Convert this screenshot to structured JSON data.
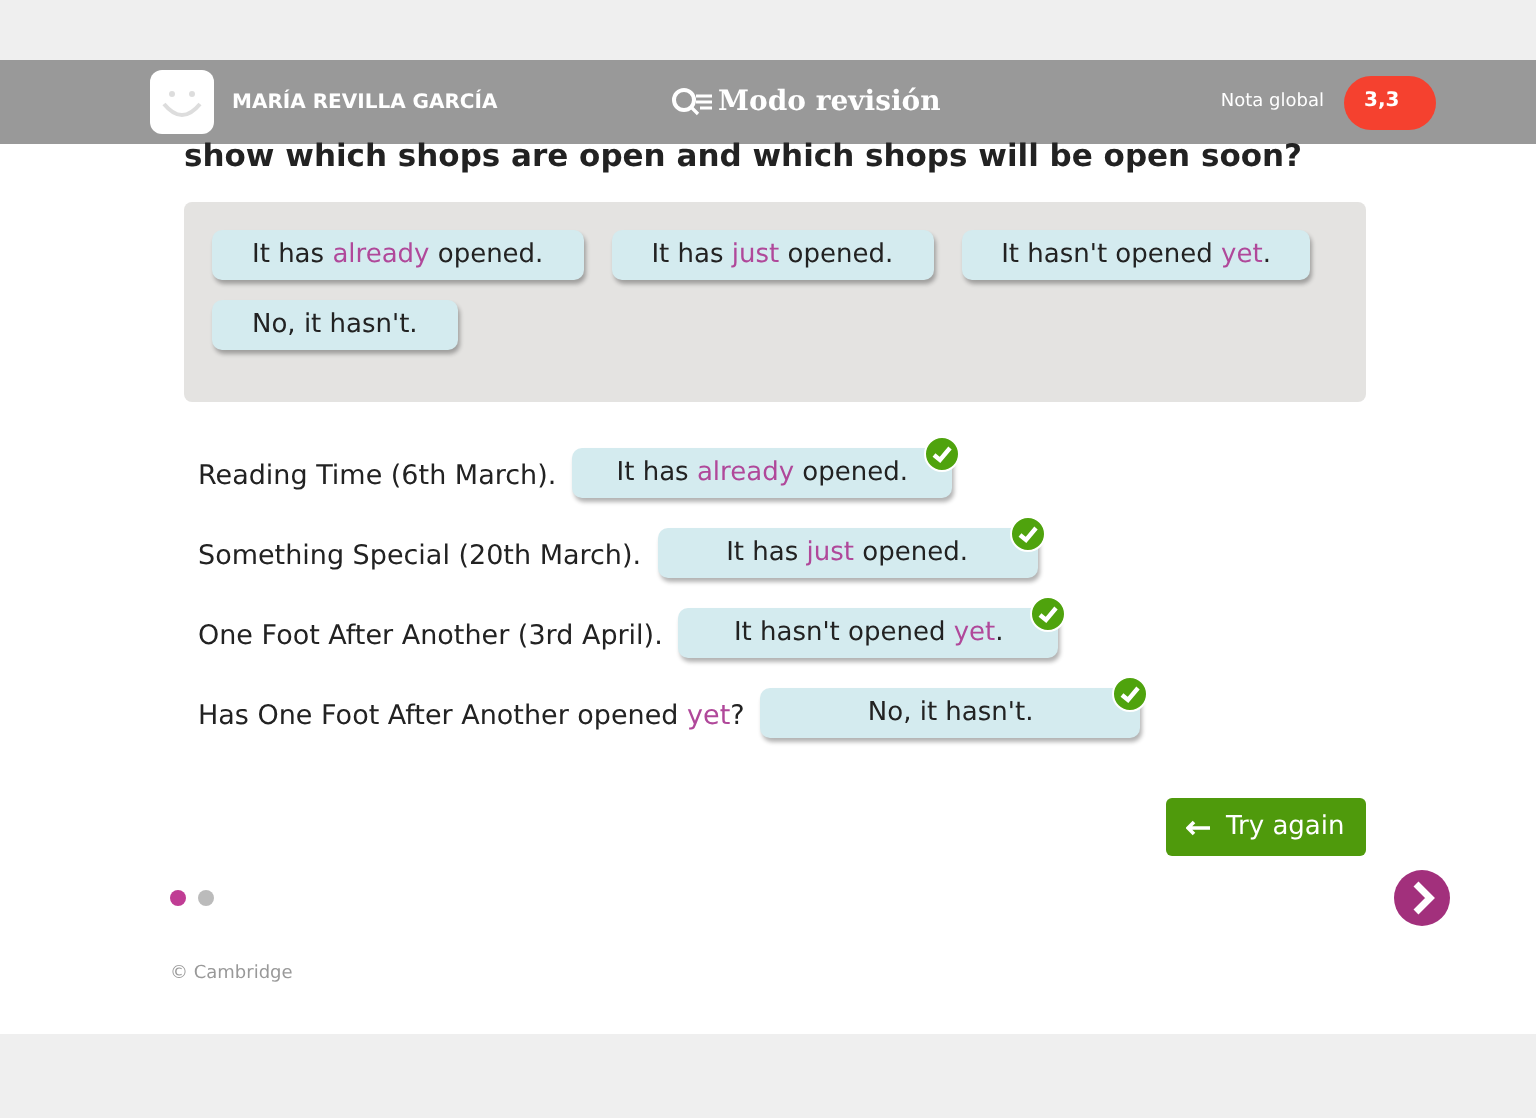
{
  "header": {
    "user_name": "MARÍA REVILLA GARCÍA",
    "mode": "Modo revisión",
    "grade_label": "Nota global",
    "grade": "3,3"
  },
  "question": "show which shops are open and which shops will be open soon?",
  "word_bank": [
    "It has *already* opened.",
    "It has *just* opened.",
    "It hasn't opened *yet*.",
    "No, it hasn't."
  ],
  "sentences": [
    {
      "prompt": "Reading Time (6th March).",
      "answer": "It has *already* opened.",
      "correct": true
    },
    {
      "prompt": "Something Special (20th March).",
      "answer": "It has *just* opened.",
      "correct": true
    },
    {
      "prompt": "One Foot After Another (3rd April).",
      "answer": "It hasn't opened *yet*.",
      "correct": true
    },
    {
      "prompt": "Has One Foot After Another opened *yet*?",
      "answer": "No, it hasn't.",
      "correct": true
    }
  ],
  "try_again": "Try again",
  "pages": [
    {
      "selected": true
    },
    {
      "selected": false
    }
  ],
  "copyright": "© Cambridge"
}
